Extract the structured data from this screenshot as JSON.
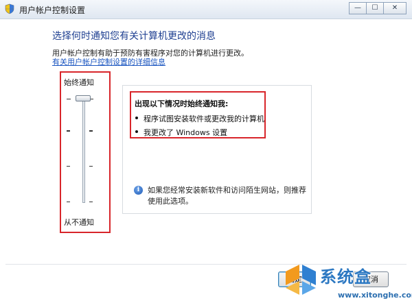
{
  "window": {
    "title": "用户帐户控制设置",
    "controls": {
      "minimize": "—",
      "maximize": "☐",
      "close": "✕"
    }
  },
  "main": {
    "heading": "选择何时通知您有关计算机更改的消息",
    "description": "用户帐户控制有助于预防有害程序对您的计算机进行更改。",
    "link": "有关用户帐户控制设置的详细信息"
  },
  "slider": {
    "top_label": "始终通知",
    "bottom_label": "从不通知",
    "levels": 4,
    "selected_level": 4
  },
  "info_panel": {
    "title": "出现以下情况时始终通知我:",
    "bullets": [
      "程序试图安装软件或更改我的计算机",
      "我更改了 Windows 设置"
    ],
    "recommendation": "如果您经常安装新软件和访问陌生网站，则推荐使用此选项。"
  },
  "buttons": {
    "ok": "确定",
    "cancel": "取消"
  },
  "watermark": {
    "brand": "系统盒",
    "url": "www.xitonghe.com"
  },
  "colors": {
    "heading": "#1e3f91",
    "link": "#1a55c0",
    "highlight_border": "#d8252a"
  },
  "icons": {
    "title": "shield-icon",
    "info": "info-icon",
    "logo": "xitonghe-logo-icon"
  }
}
